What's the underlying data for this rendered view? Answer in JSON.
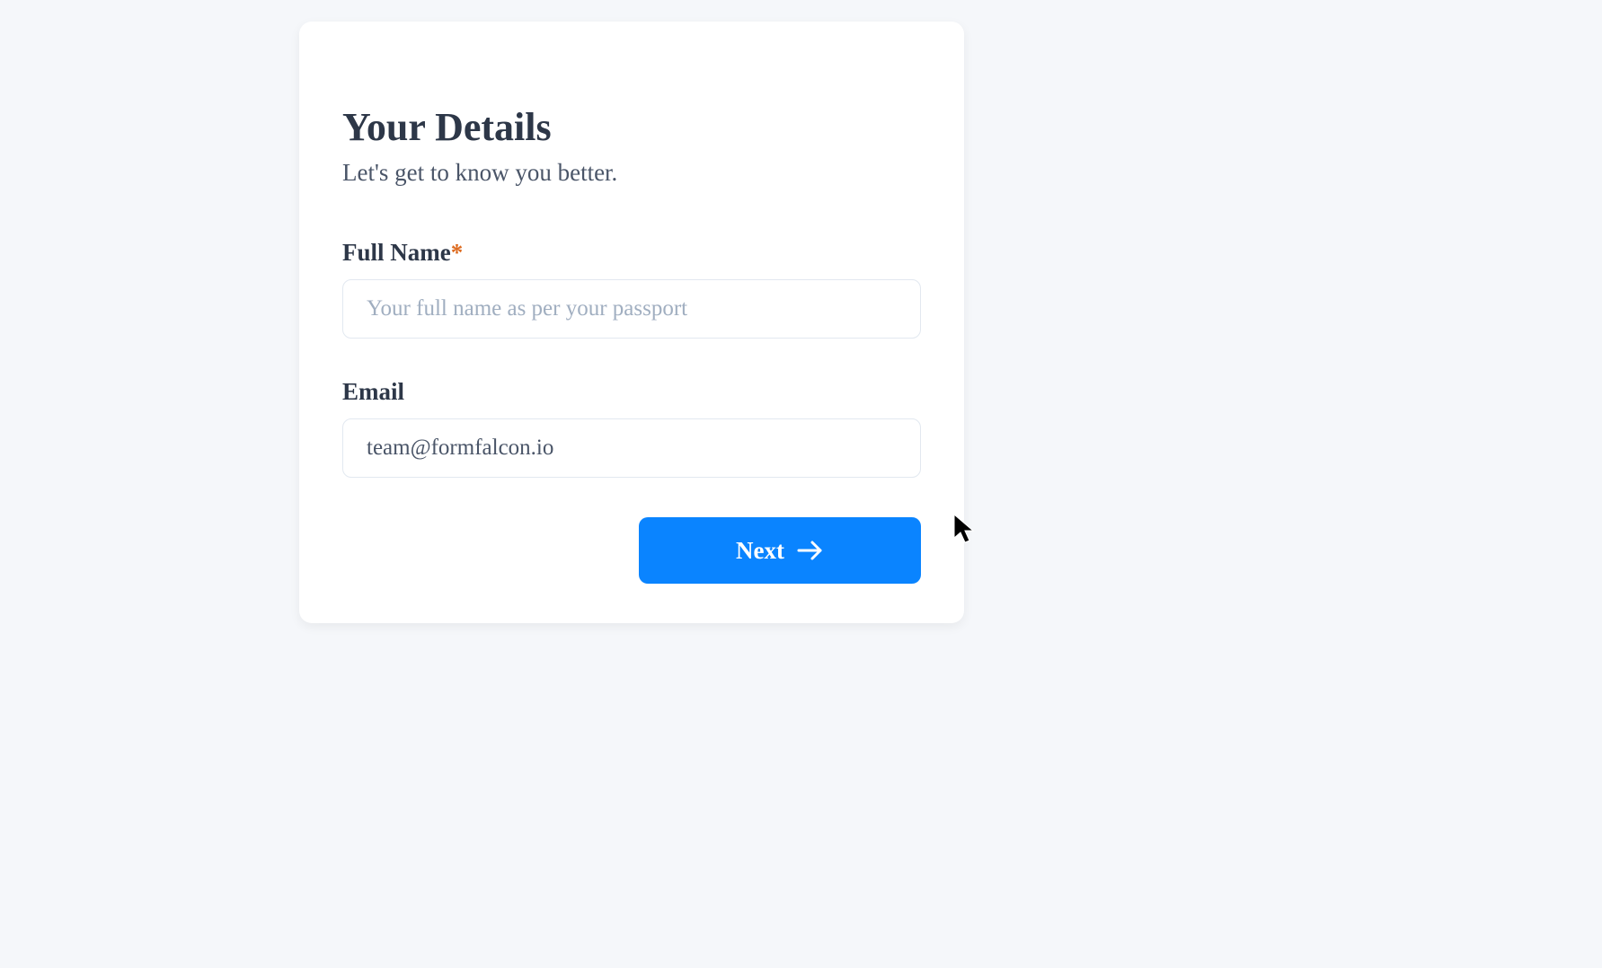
{
  "form": {
    "title": "Your Details",
    "subtitle": "Let's get to know you better.",
    "fields": {
      "full_name": {
        "label": "Full Name",
        "required_marker": "*",
        "placeholder": "Your full name as per your passport",
        "value": ""
      },
      "email": {
        "label": "Email",
        "placeholder": "",
        "value": "team@formfalcon.io"
      }
    },
    "buttons": {
      "next_label": "Next"
    }
  }
}
